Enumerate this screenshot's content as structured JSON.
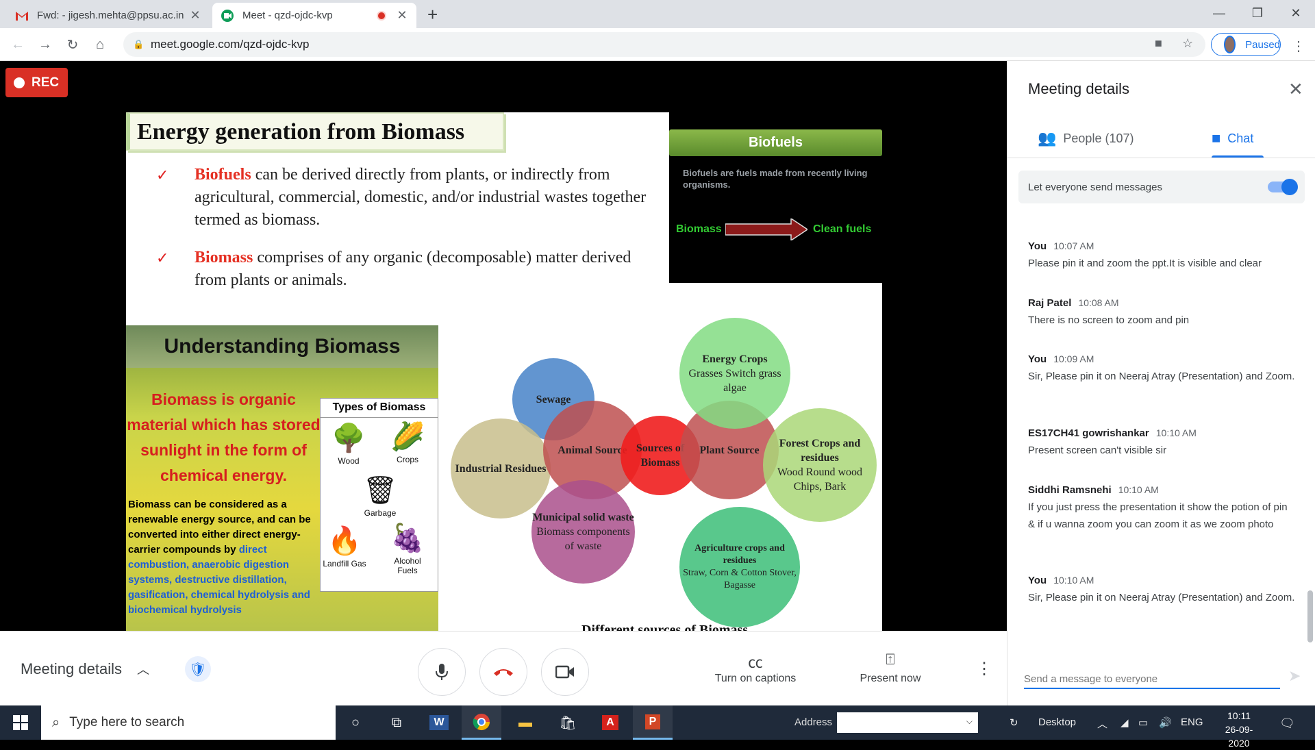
{
  "browser": {
    "tabs": [
      {
        "title": "Fwd: - jigesh.mehta@ppsu.ac.in",
        "active": false
      },
      {
        "title": "Meet - qzd-ojdc-kvp",
        "active": true
      }
    ],
    "url": "meet.google.com/qzd-ojdc-kvp",
    "profile_status": "Paused"
  },
  "stage": {
    "rec_label": "REC"
  },
  "slide": {
    "title": "Energy generation from Biomass",
    "bullet1_kw": "Biofuels",
    "bullet1_text": " can be derived directly from plants, or indirectly from agricultural, commercial, domestic, and/or industrial wastes together termed as biomass.",
    "bullet2_kw": "Biomass",
    "bullet2_text": " comprises of any organic (decomposable) matter derived from plants or animals.",
    "biofuels_panel": {
      "heading": "Biofuels",
      "description": "Biofuels are fuels made from recently living organisms.",
      "left_label": "Biomass",
      "right_label": "Clean fuels"
    },
    "understanding": {
      "heading": "Understanding Biomass",
      "big_text": "Biomass is organic material which has stored sunlight in the form of chemical energy.",
      "small_text": "Biomass can be considered as a renewable energy source, and can be converted into either direct energy-carrier compounds by ",
      "small_text_blue": "direct combustion, anaerobic digestion systems, destructive distillation, gasification, chemical hydrolysis and biochemical hydrolysis",
      "types_heading": "Types of Biomass",
      "types": [
        "Wood",
        "Crops",
        "Garbage",
        "Landfill Gas",
        "Alcohol Fuels"
      ]
    },
    "diagram": {
      "center": "Sources of Biomass",
      "animal": "Animal Source",
      "plant": "Plant Source",
      "sewage": "Sewage",
      "industrial": "Industrial Residues",
      "municipal_title": "Municipal solid waste",
      "municipal_sub": "Biomass components of waste",
      "energy_title": "Energy Crops",
      "energy_sub": "Grasses Switch grass algae",
      "forest_title": "Forest Crops and residues",
      "forest_sub": "Wood Round wood Chips, Bark",
      "agri_title": "Agriculture crops and residues",
      "agri_sub": "Straw, Corn & Cotton Stover, Bagasse",
      "footer": "Different sources of Biomass"
    }
  },
  "controls": {
    "meeting_details": "Meeting details",
    "captions": "Turn on captions",
    "present": "Present now"
  },
  "panel": {
    "title": "Meeting details",
    "people_tab": "People (107)",
    "chat_tab": "Chat",
    "toggle_label": "Let everyone send messages",
    "compose_placeholder": "Send a message to everyone",
    "messages": [
      {
        "sender": "You",
        "time": "10:07 AM",
        "text": "Please pin it and zoom the ppt.It is visible and clear"
      },
      {
        "sender": "Raj Patel",
        "time": "10:08 AM",
        "text": "There is no screen to zoom and pin"
      },
      {
        "sender": "You",
        "time": "10:09 AM",
        "text": "Sir, Please pin it on Neeraj Atray (Presentation) and Zoom."
      },
      {
        "sender": "ES17CH41 gowrishankar",
        "time": "10:10 AM",
        "text": "Present screen can't visible sir"
      },
      {
        "sender": "Siddhi Ramsnehi",
        "time": "10:10 AM",
        "text": "If you just press the presentation it show the potion of pin & if u wanna zoom you can zoom it as we zoom photo"
      },
      {
        "sender": "You",
        "time": "10:10 AM",
        "text": "Sir, Please pin it on Neeraj Atray (Presentation) and Zoom."
      }
    ]
  },
  "taskbar": {
    "search_placeholder": "Type here to search",
    "address_label": "Address",
    "desktop_label": "Desktop",
    "lang": "ENG",
    "time": "10:11",
    "date": "26-09-2020"
  },
  "colors": {
    "accent": "#1a73e8",
    "rec": "#d93025",
    "keyword_red": "#e53124",
    "biofuel_green": "#33cc33"
  }
}
